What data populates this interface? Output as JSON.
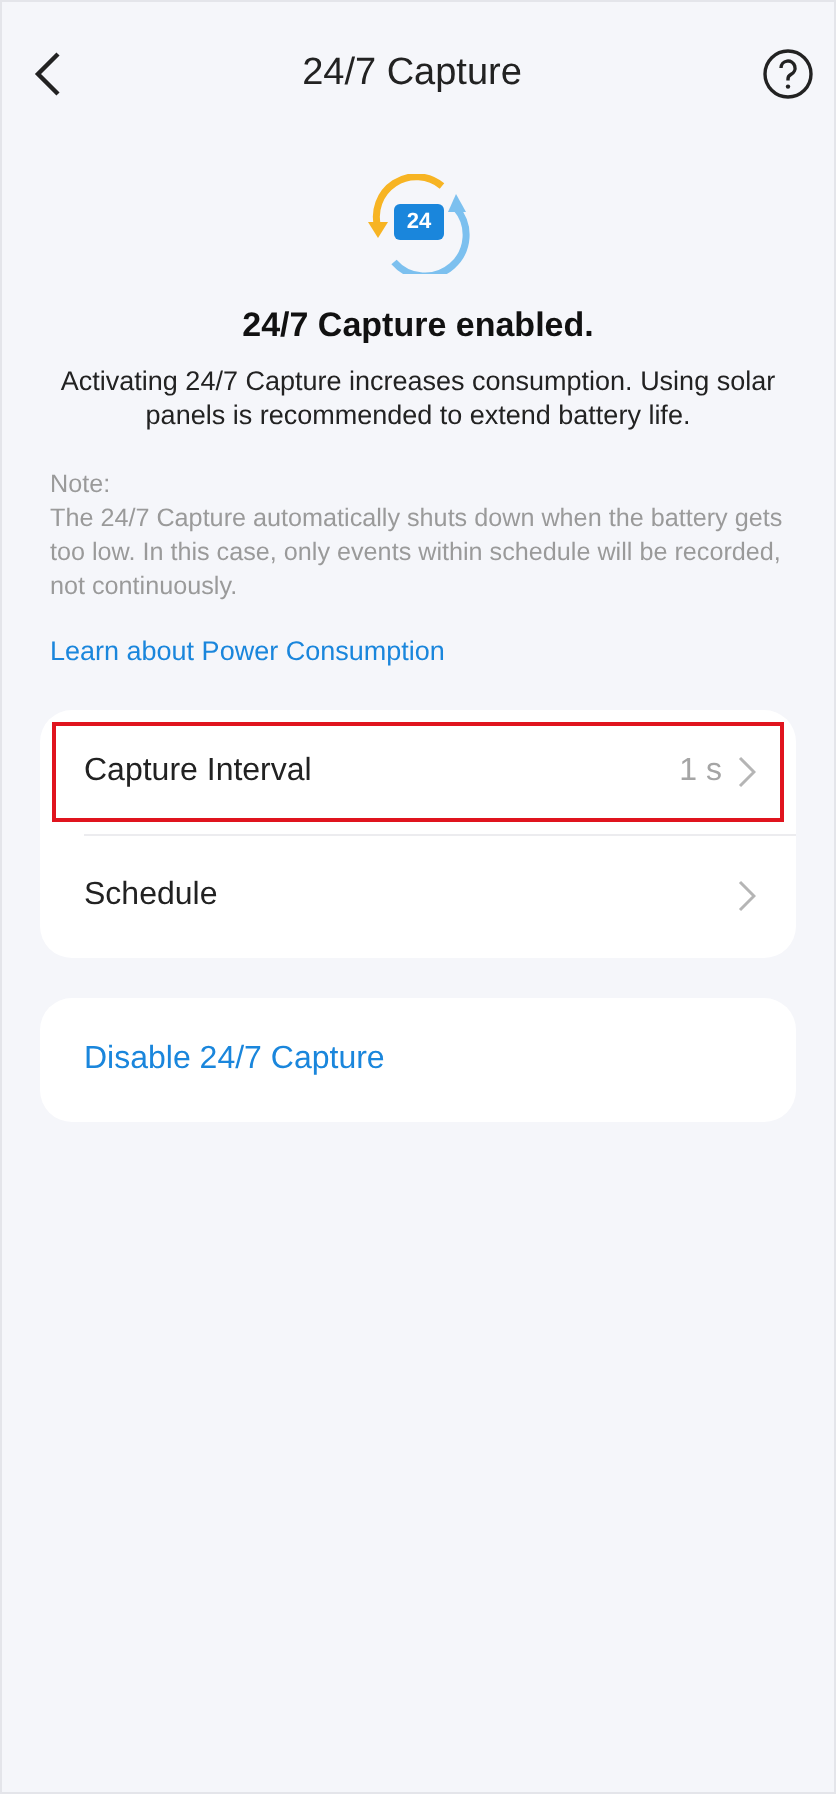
{
  "header": {
    "title": "24/7 Capture"
  },
  "hero": {
    "icon_text": "24",
    "title": "24/7 Capture enabled.",
    "description": "Activating 24/7 Capture increases consumption. Using solar panels is recommended to extend battery life."
  },
  "note": {
    "label": "Note:",
    "text": "The 24/7 Capture automatically shuts down when the battery gets too low. In this case, only events within schedule will be recorded, not continuously."
  },
  "link": "Learn about Power Consumption",
  "settings": [
    {
      "label": "Capture Interval",
      "value": "1 s",
      "highlighted": true
    },
    {
      "label": "Schedule",
      "highlighted": false
    }
  ],
  "action": "Disable 24/7 Capture"
}
